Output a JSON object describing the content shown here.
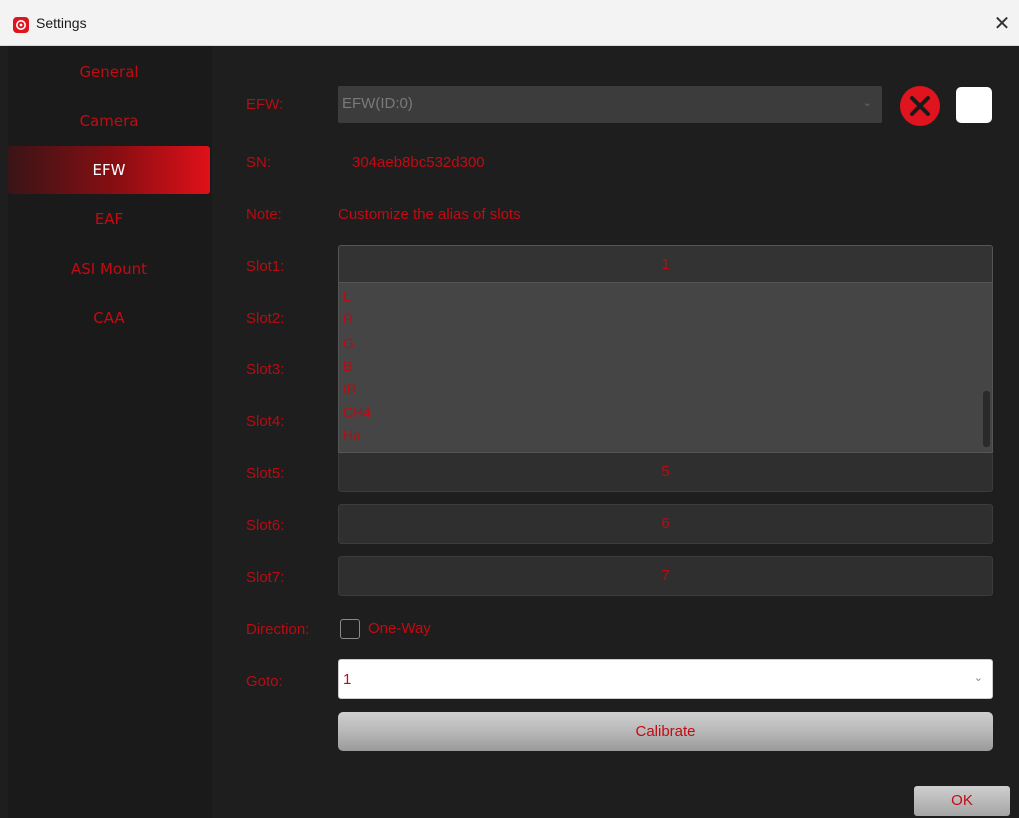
{
  "window": {
    "title": "Settings",
    "app_icon": "app-logo-icon",
    "close_icon": "close-icon"
  },
  "sidebar": {
    "items": [
      {
        "label": "General",
        "active": false
      },
      {
        "label": "Camera",
        "active": false
      },
      {
        "label": "EFW",
        "active": true
      },
      {
        "label": "EAF",
        "active": false
      },
      {
        "label": "ASI Mount",
        "active": false
      },
      {
        "label": "CAA",
        "active": false
      }
    ]
  },
  "efw": {
    "label": "EFW:",
    "selected": "EFW(ID:0)",
    "sn_label": "SN:",
    "sn_value": "304aeb8bc532d300",
    "note_label": "Note:",
    "note_text": "Customize the alias of slots"
  },
  "slots": [
    {
      "label": "Slot1:",
      "value": "1"
    },
    {
      "label": "Slot2:",
      "value": ""
    },
    {
      "label": "Slot3:",
      "value": ""
    },
    {
      "label": "Slot4:",
      "value": ""
    },
    {
      "label": "Slot5:",
      "value": "5"
    },
    {
      "label": "Slot6:",
      "value": "6"
    },
    {
      "label": "Slot7:",
      "value": "7"
    }
  ],
  "slot_dropdown_options": [
    "L",
    "R",
    "G",
    "B",
    "IR",
    "CH4",
    "Ha"
  ],
  "direction": {
    "label": "Direction:",
    "checkbox_label": "One-Way",
    "checked": false
  },
  "goto": {
    "label": "Goto:",
    "value": "1"
  },
  "buttons": {
    "calibrate": "Calibrate",
    "ok": "OK"
  },
  "colors": {
    "accent_red": "#c40a12",
    "background": "#1e1e1e"
  }
}
